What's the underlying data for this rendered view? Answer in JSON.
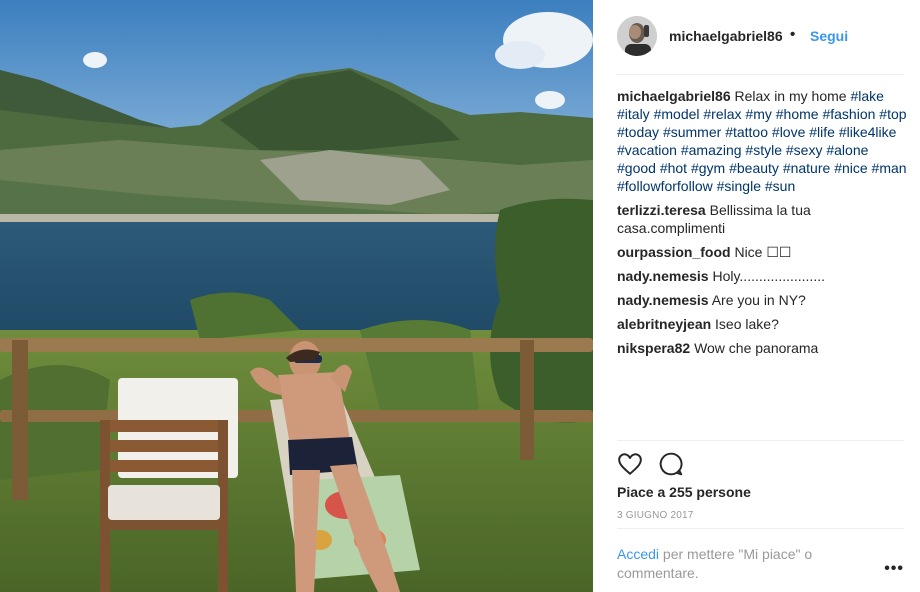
{
  "post": {
    "username": "michaelgabriel86",
    "dot": "•",
    "follow_label": "Segui",
    "caption": {
      "username": "michaelgabriel86",
      "text": "Relax in my home",
      "hashtags": [
        "#lake",
        "#italy",
        "#model",
        "#relax",
        "#my",
        "#home",
        "#fashion",
        "#top",
        "#today",
        "#summer",
        "#tattoo",
        "#love",
        "#life",
        "#like4like",
        "#vacation",
        "#amazing",
        "#style",
        "#sexy",
        "#alone",
        "#good",
        "#hot",
        "#gym",
        "#beauty",
        "#nature",
        "#nice",
        "#man",
        "#followforfollow",
        "#single",
        "#sun"
      ]
    },
    "comments": [
      {
        "user": "terlizzi.teresa",
        "text": "Bellissima la tua casa.complimenti"
      },
      {
        "user": "ourpassion_food",
        "text": "Nice ☐☐"
      },
      {
        "user": "nady.nemesis",
        "text": "Holy......................"
      },
      {
        "user": "nady.nemesis",
        "text": "Are you in NY?"
      },
      {
        "user": "alebritneyjean",
        "text": "Iseo lake?"
      },
      {
        "user": "nikspera82",
        "text": "Wow che panorama"
      }
    ],
    "likes_text": "Piace a 255 persone",
    "date": "3 GIUGNO 2017",
    "login": {
      "link": "Accedi",
      "text": "per mettere \"Mi piace\" o commentare."
    },
    "more": "•••",
    "icons": {
      "like": "heart-icon",
      "comment": "comment-icon",
      "more": "more-options-icon"
    },
    "colors": {
      "link_blue": "#3897f0",
      "hashtag": "#003569",
      "muted": "#999999",
      "text": "#262626"
    }
  }
}
